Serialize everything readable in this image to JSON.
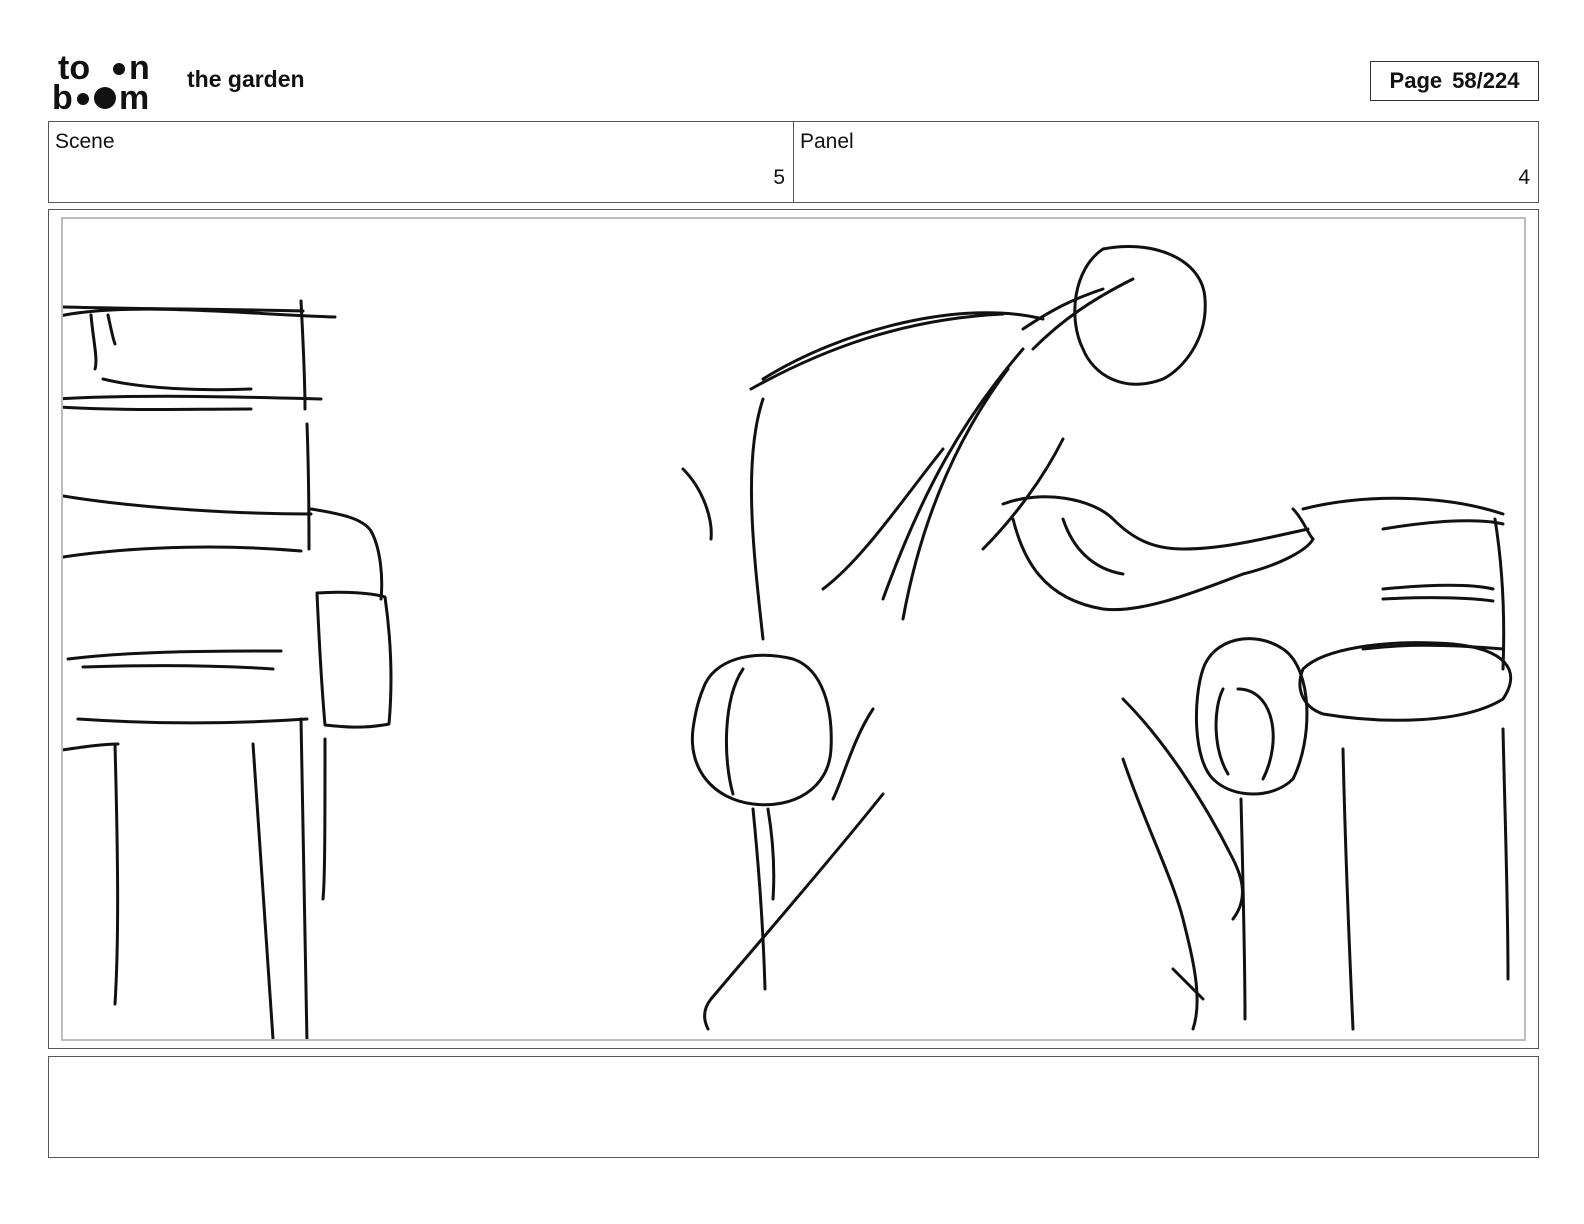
{
  "header": {
    "logo": {
      "name": "toonboom-logo",
      "line1": "to",
      "line1_end": "n",
      "line2_start": "b",
      "line2_end": "m"
    },
    "project_title": "the garden",
    "page_label": "Page",
    "page_number": "58/224"
  },
  "info": {
    "scene_label": "Scene",
    "scene_value": "5",
    "panel_label": "Panel",
    "panel_value": "4"
  },
  "panel": {
    "content": "rough pencil sketch"
  },
  "notes": {
    "text": ""
  }
}
